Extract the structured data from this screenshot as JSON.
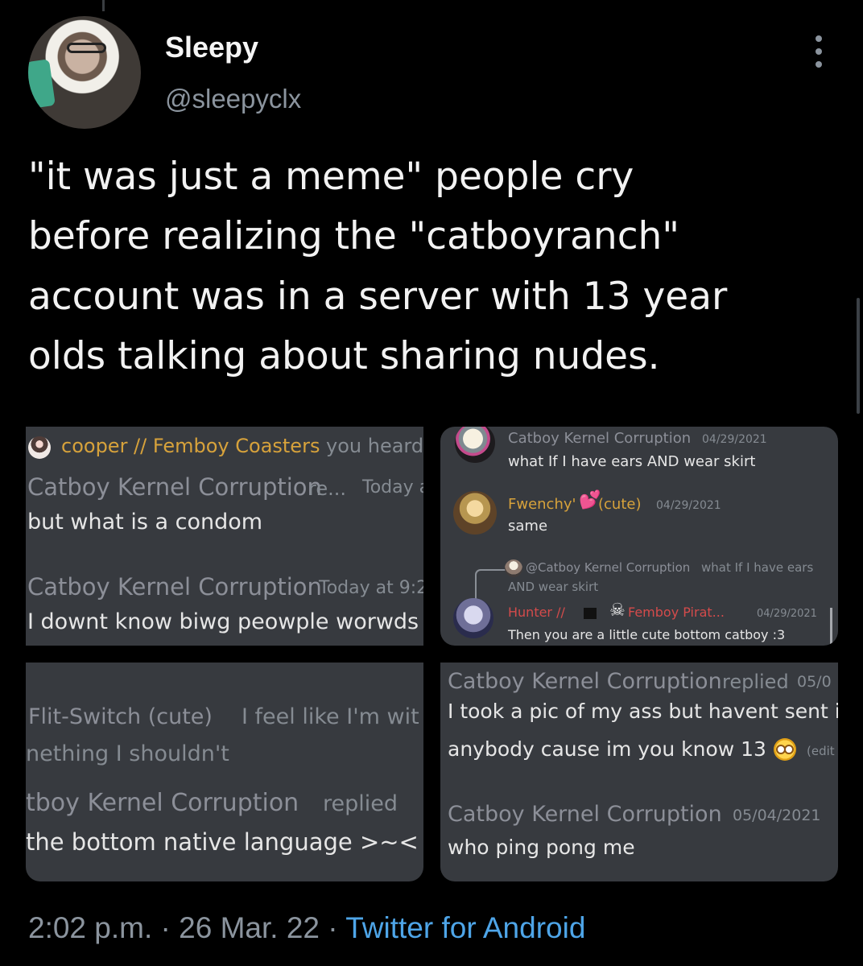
{
  "tweet": {
    "display_name": "Sleepy",
    "handle": "@sleepyclx",
    "text": "\"it was just a meme\" people cry\nbefore realizing the \"catboyranch\"\naccount was in a server with 13 year\nolds talking about sharing nudes.",
    "time": "2:02 p.m.",
    "separator_1": " · ",
    "date": "26 Mar. 22",
    "separator_2": " · ",
    "source": "Twitter for Android",
    "more_icon": "three-vertical-dots",
    "avatar_icon": "profile-photo"
  },
  "screenshots": {
    "top_left": {
      "line1_name": "cooper // Femboy Coasters",
      "line1_text": " you heard",
      "line2_name": "Catboy Kernel Corruption",
      "line2_reply": " re...",
      "line2_time": "Today a",
      "line3": "but what is a condom",
      "line4_name": "Catboy Kernel Corruption",
      "line4_time": "Today at 9:2",
      "line5": "I downt know biwg peowple worwds >"
    },
    "top_right": {
      "msg1_name": "Catboy Kernel Corruption",
      "msg1_time": "04/29/2021",
      "msg1_text": "what If I have ears AND wear skirt",
      "msg2_name": "Fwenchy'",
      "msg2_heart": "💕",
      "msg2_tag": " (cute)",
      "msg2_time": "04/29/2021",
      "msg2_text": "same",
      "reply_name": "@Catboy Kernel Corruption",
      "reply_text": " what If I have ears",
      "reply_text_2": "AND wear skirt",
      "msg3_name_1": "Hunter //",
      "msg3_skull": "☠",
      "msg3_name_2": " Femboy Pirat...",
      "msg3_time": "04/29/2021",
      "msg3_text": "Then you are a little cute bottom catboy :3"
    },
    "bottom_left": {
      "line1_name": "Flit-Switch (cute)",
      "line1_text": " I feel like I'm wit",
      "line2": "nething I shouldn't",
      "line3_name": "tboy Kernel Corruption",
      "line3_reply": " replied",
      "line4": "the bottom native language >~<"
    },
    "bottom_right": {
      "line1_name": "Catboy Kernel Corruption",
      "line1_reply": " replied",
      "line1_time": "05/0",
      "line2": "I took a pic of my ass but havent sent i",
      "line3": "anybody cause im you know 13",
      "line3_edit": "(edit",
      "line4_name": "Catboy Kernel Corruption",
      "line4_time": "05/04/2021",
      "line5": "who ping pong me"
    }
  },
  "colors": {
    "background": "#000000",
    "panel": "#373a3f",
    "link": "#4ea5e8",
    "name_blue": "#8c8f98",
    "name_gold": "#d7a23b",
    "name_red": "#d44b4b"
  }
}
